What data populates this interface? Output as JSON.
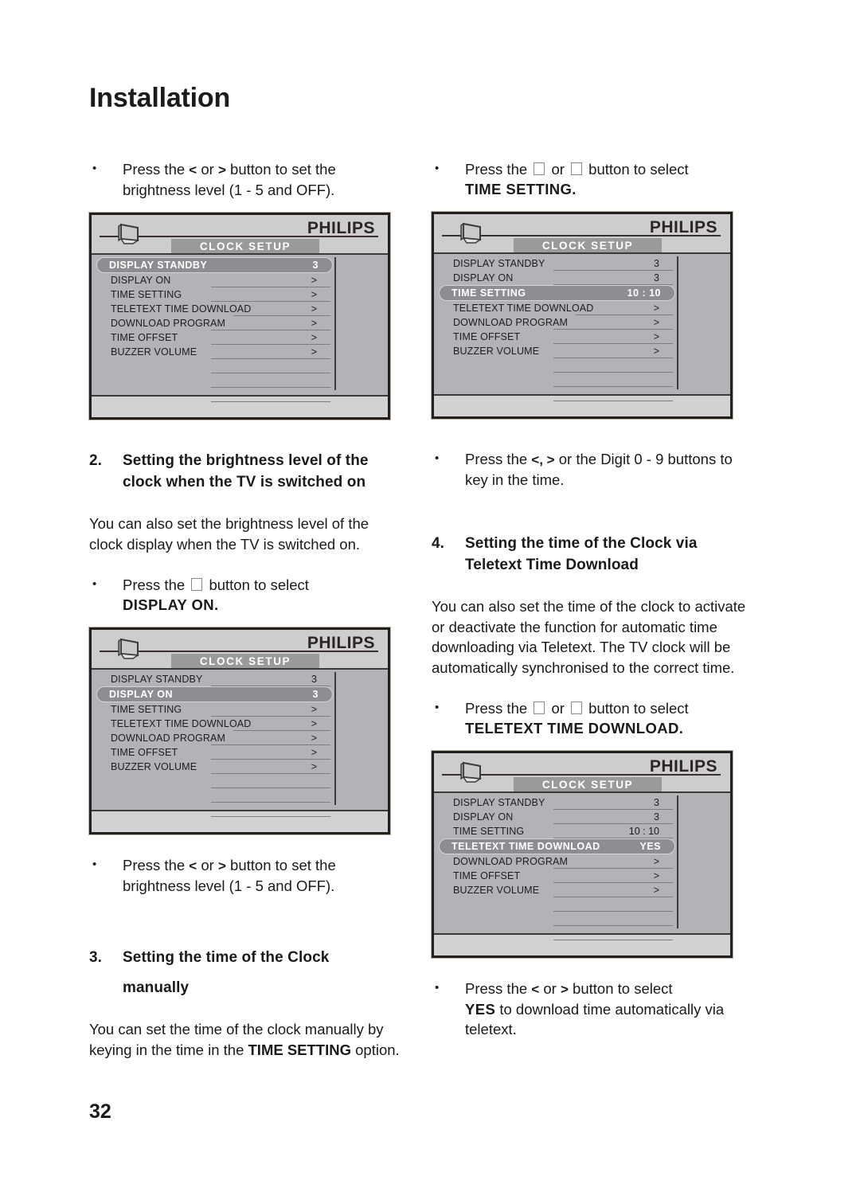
{
  "page": {
    "title": "Installation",
    "number": "32"
  },
  "left_column": {
    "bullet_1": {
      "pre": "Press the",
      "key_left": "<",
      "or": "or",
      "key_right": ">",
      "post": "button to set the brightness level (1 - 5 and OFF)."
    },
    "heading_2": {
      "number": "2.",
      "text": "Setting the brightness level of the clock when the TV is switched on"
    },
    "para_1": "You can also set the brightness level of the clock display when the TV is switched on.",
    "bullet_2": {
      "pre": "Press the",
      "post": "button to select",
      "bold": "DISPLAY ON."
    },
    "bullet_3": {
      "pre": "Press the",
      "key_left": "<",
      "or": "or",
      "key_right": ">",
      "post": "button to set the brightness level (1 - 5 and OFF)."
    },
    "heading_3": {
      "number": "3.",
      "line1": "Setting the time of the Clock",
      "line2": "manually"
    },
    "para_2_a": "You can set the time of the clock manually by keying in the time in the ",
    "para_2_bold1": "TIME SETTING",
    "para_2_b": " option."
  },
  "right_column": {
    "bullet_1": {
      "pre": "Press the",
      "or": "or",
      "post": "button to select",
      "bold": "TIME SETTING."
    },
    "bullet_2": {
      "pre": "Press the",
      "keys": "<, >",
      "post": "or the Digit 0 - 9 buttons to key in the time."
    },
    "heading_4": {
      "number": "4.",
      "text": "Setting the time of the Clock via Teletext Time Download"
    },
    "para_1": "You can also set the time of the clock to activate or deactivate the function for automatic time downloading via Teletext. The TV clock will be automatically synchronised to the correct time.",
    "bullet_3": {
      "pre": "Press the",
      "or": "or",
      "post": "button to select",
      "bold": "TELETEXT TIME DOWNLOAD."
    },
    "bullet_4": {
      "pre": "Press the",
      "key_left": "<",
      "or": "or",
      "key_right": ">",
      "post_a": "button to select",
      "bold": "YES",
      "post_b": "to download time automatically via teletext."
    }
  },
  "osd_common": {
    "brand": "PHILIPS",
    "menu_title": "CLOCK SETUP",
    "arrow_value": ">"
  },
  "osd_menus": [
    {
      "id": "menu-display-standby",
      "rows": [
        {
          "label": "DISPLAY STANDBY",
          "value": "3",
          "selected": true
        },
        {
          "label": "DISPLAY ON",
          "value": ">",
          "selected": false
        },
        {
          "label": "TIME SETTING",
          "value": ">",
          "selected": false
        },
        {
          "label": "TELETEXT TIME DOWNLOAD",
          "value": ">",
          "selected": false,
          "wide": true
        },
        {
          "label": "DOWNLOAD PROGRAM",
          "value": ">",
          "selected": false
        },
        {
          "label": "TIME OFFSET",
          "value": ">",
          "selected": false
        },
        {
          "label": "BUZZER VOLUME",
          "value": ">",
          "selected": false
        },
        {
          "label": "",
          "value": "",
          "selected": false
        },
        {
          "label": "",
          "value": "",
          "selected": false
        },
        {
          "label": "",
          "value": "",
          "selected": false
        }
      ]
    },
    {
      "id": "menu-time-setting",
      "rows": [
        {
          "label": "DISPLAY STANDBY",
          "value": "3",
          "selected": false
        },
        {
          "label": "DISPLAY ON",
          "value": "3",
          "selected": false
        },
        {
          "label": "TIME SETTING",
          "value": "10 : 10",
          "selected": true
        },
        {
          "label": "TELETEXT TIME DOWNLOAD",
          "value": ">",
          "selected": false,
          "wide": true
        },
        {
          "label": "DOWNLOAD PROGRAM",
          "value": ">",
          "selected": false
        },
        {
          "label": "TIME OFFSET",
          "value": ">",
          "selected": false
        },
        {
          "label": "BUZZER VOLUME",
          "value": ">",
          "selected": false
        },
        {
          "label": "",
          "value": "",
          "selected": false
        },
        {
          "label": "",
          "value": "",
          "selected": false
        },
        {
          "label": "",
          "value": "",
          "selected": false
        }
      ]
    },
    {
      "id": "menu-display-on",
      "rows": [
        {
          "label": "DISPLAY STANDBY",
          "value": "3",
          "selected": false
        },
        {
          "label": "DISPLAY ON",
          "value": "3",
          "selected": true
        },
        {
          "label": "TIME SETTING",
          "value": ">",
          "selected": false
        },
        {
          "label": "TELETEXT TIME DOWNLOAD",
          "value": ">",
          "selected": false,
          "wide": true
        },
        {
          "label": "DOWNLOAD PROGRAM",
          "value": ">",
          "selected": false
        },
        {
          "label": "TIME OFFSET",
          "value": ">",
          "selected": false
        },
        {
          "label": "BUZZER VOLUME",
          "value": ">",
          "selected": false
        },
        {
          "label": "",
          "value": "",
          "selected": false
        },
        {
          "label": "",
          "value": "",
          "selected": false
        },
        {
          "label": "",
          "value": "",
          "selected": false
        }
      ]
    },
    {
      "id": "menu-teletext-time-download",
      "rows": [
        {
          "label": "DISPLAY STANDBY",
          "value": "3",
          "selected": false
        },
        {
          "label": "DISPLAY ON",
          "value": "3",
          "selected": false
        },
        {
          "label": "TIME SETTING",
          "value": "10 : 10",
          "selected": false
        },
        {
          "label": "TELETEXT TIME DOWNLOAD",
          "value": "YES",
          "selected": true
        },
        {
          "label": "DOWNLOAD PROGRAM",
          "value": ">",
          "selected": false
        },
        {
          "label": "TIME OFFSET",
          "value": ">",
          "selected": false
        },
        {
          "label": "BUZZER VOLUME",
          "value": ">",
          "selected": false
        },
        {
          "label": "",
          "value": "",
          "selected": false
        },
        {
          "label": "",
          "value": "",
          "selected": false
        },
        {
          "label": "",
          "value": "",
          "selected": false
        }
      ]
    }
  ]
}
